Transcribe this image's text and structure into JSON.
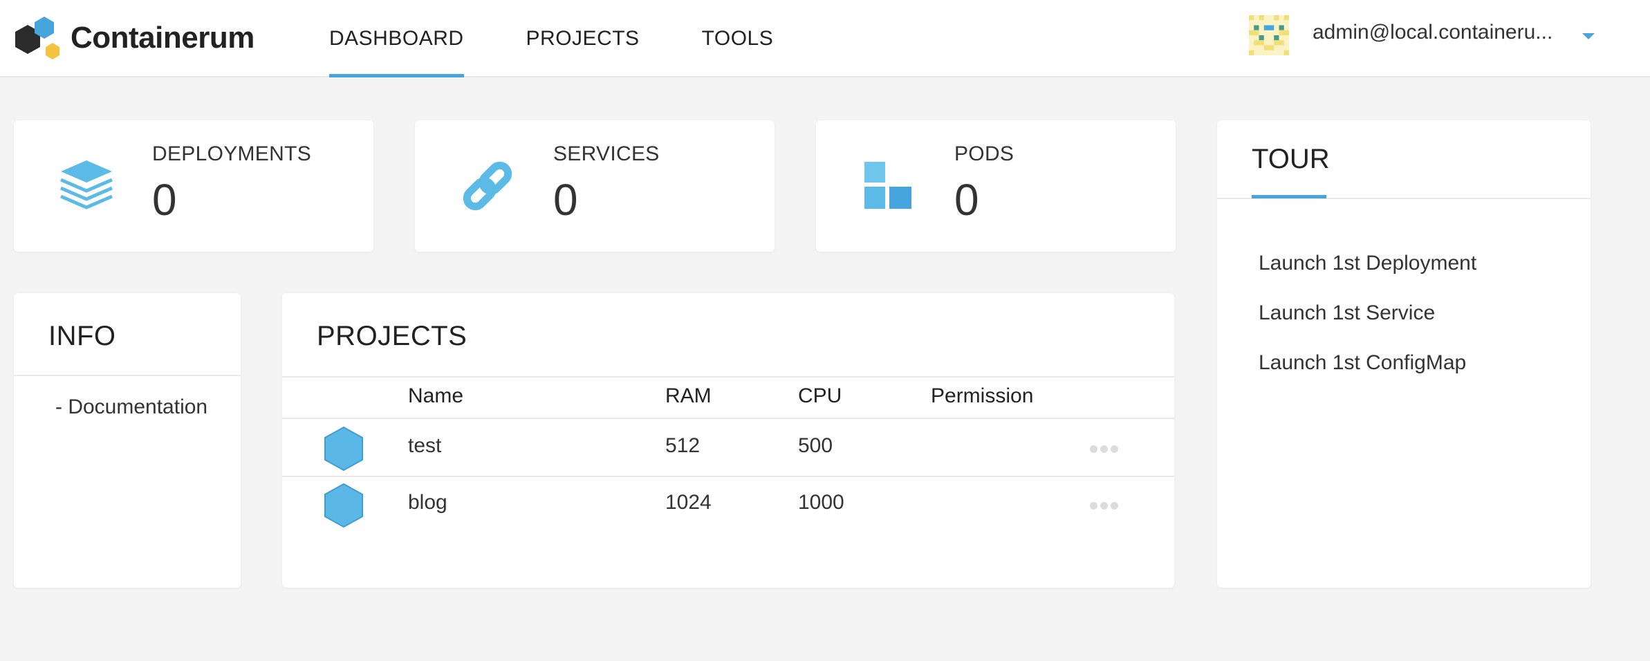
{
  "app": {
    "name": "Containerum"
  },
  "nav": {
    "items": [
      {
        "label": "DASHBOARD",
        "active": true
      },
      {
        "label": "PROJECTS",
        "active": false
      },
      {
        "label": "TOOLS",
        "active": false
      }
    ]
  },
  "user": {
    "email": "admin@local.containeru..."
  },
  "stats": {
    "deployments": {
      "label": "DEPLOYMENTS",
      "value": "0",
      "icon": "layers-icon"
    },
    "services": {
      "label": "SERVICES",
      "value": "0",
      "icon": "link-icon"
    },
    "pods": {
      "label": "PODS",
      "value": "0",
      "icon": "blocks-icon"
    }
  },
  "info": {
    "title": "INFO",
    "links": [
      "- Documentation"
    ]
  },
  "projects": {
    "title": "PROJECTS",
    "columns": [
      "Name",
      "RAM",
      "CPU",
      "Permission"
    ],
    "rows": [
      {
        "name": "test",
        "ram": "512",
        "cpu": "500",
        "permission": ""
      },
      {
        "name": "blog",
        "ram": "1024",
        "cpu": "1000",
        "permission": ""
      }
    ]
  },
  "tour": {
    "title": "TOUR",
    "items": [
      "Launch 1st Deployment",
      "Launch 1st Service",
      "Launch 1st ConfigMap"
    ]
  },
  "colors": {
    "accent": "#45a5dc",
    "background": "#f4f4f4",
    "card": "#ffffff"
  }
}
